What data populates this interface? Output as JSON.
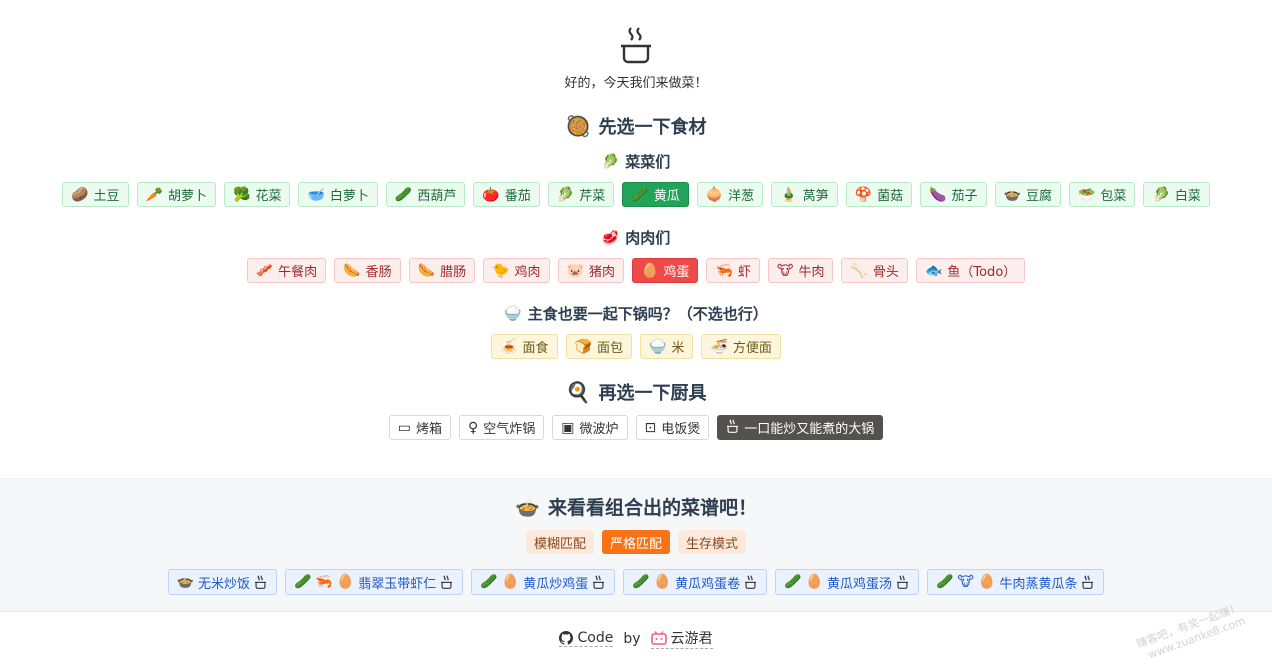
{
  "header": {
    "subtitle": "好的，今天我们来做菜！"
  },
  "ingredients": {
    "title": "先选一下食材",
    "veg_title": "菜菜们",
    "vegetables": [
      {
        "icon": "🥔",
        "label": "土豆"
      },
      {
        "icon": "🥕",
        "label": "胡萝卜"
      },
      {
        "icon": "🥦",
        "label": "花菜"
      },
      {
        "icon": "🥣",
        "label": "白萝卜"
      },
      {
        "icon": "🥒",
        "label": "西葫芦"
      },
      {
        "icon": "🍅",
        "label": "番茄"
      },
      {
        "icon": "🥬",
        "label": "芹菜"
      },
      {
        "icon": "🥒",
        "label": "黄瓜",
        "active": true
      },
      {
        "icon": "🧅",
        "label": "洋葱"
      },
      {
        "icon": "🎍",
        "label": "莴笋"
      },
      {
        "icon": "🍄",
        "label": "菌菇"
      },
      {
        "icon": "🍆",
        "label": "茄子"
      },
      {
        "icon": "🍲",
        "label": "豆腐"
      },
      {
        "icon": "🥗",
        "label": "包菜"
      },
      {
        "icon": "🥬",
        "label": "白菜"
      }
    ],
    "meat_title": "肉肉们",
    "meats": [
      {
        "icon": "🥓",
        "label": "午餐肉"
      },
      {
        "icon": "🌭",
        "label": "香肠"
      },
      {
        "icon": "🌭",
        "label": "腊肠"
      },
      {
        "icon": "🐤",
        "label": "鸡肉"
      },
      {
        "icon": "🐷",
        "label": "猪肉"
      },
      {
        "icon": "🥚",
        "label": "鸡蛋",
        "active": true
      },
      {
        "icon": "🦐",
        "label": "虾"
      },
      {
        "icon": "🐮",
        "label": "牛肉"
      },
      {
        "icon": "🦴",
        "label": "骨头"
      },
      {
        "icon": "🐟",
        "label": "鱼（Todo）"
      }
    ],
    "staple_title": "主食也要一起下锅吗？（不选也行）",
    "staples": [
      {
        "icon": "🍝",
        "label": "面食"
      },
      {
        "icon": "🍞",
        "label": "面包"
      },
      {
        "icon": "🍚",
        "label": "米"
      },
      {
        "icon": "🍜",
        "label": "方便面"
      }
    ]
  },
  "tools": {
    "title": "再选一下厨具",
    "items": [
      {
        "icon": "▭",
        "label": "烤箱"
      },
      {
        "icon": "♀",
        "label": "空气炸锅"
      },
      {
        "icon": "▣",
        "label": "微波炉"
      },
      {
        "icon": "⊡",
        "label": "电饭煲"
      },
      {
        "icon": "pot",
        "label": "一口能炒又能煮的大锅",
        "active": true
      }
    ]
  },
  "results": {
    "title": "来看看组合出的菜谱吧！",
    "modes": [
      {
        "label": "模糊匹配",
        "active": false
      },
      {
        "label": "严格匹配",
        "active": true
      },
      {
        "label": "生存模式",
        "active": false
      }
    ],
    "recipes": [
      {
        "icons": [
          "🍲"
        ],
        "label": "无米炒饭"
      },
      {
        "icons": [
          "🥒",
          "🦐",
          "🥚"
        ],
        "label": "翡翠玉带虾仁"
      },
      {
        "icons": [
          "🥒",
          "🥚"
        ],
        "label": "黄瓜炒鸡蛋"
      },
      {
        "icons": [
          "🥒",
          "🥚"
        ],
        "label": "黄瓜鸡蛋卷"
      },
      {
        "icons": [
          "🥒",
          "🥚"
        ],
        "label": "黄瓜鸡蛋汤"
      },
      {
        "icons": [
          "🥒",
          "🐮",
          "🥚"
        ],
        "label": "牛肉蒸黄瓜条"
      }
    ]
  },
  "footer": {
    "code_label": "Code",
    "by": "by",
    "author": "云游君"
  },
  "watermark": {
    "line1": "赚客吧，有奖一起赚！",
    "line2": "www.zuanke8.com"
  },
  "colors": {
    "veg_active": "#22a35a",
    "meat_active": "#ef4a4a",
    "tool_active": "#555150",
    "mode_active": "#f97316",
    "recipe_text": "#1f58c7"
  }
}
